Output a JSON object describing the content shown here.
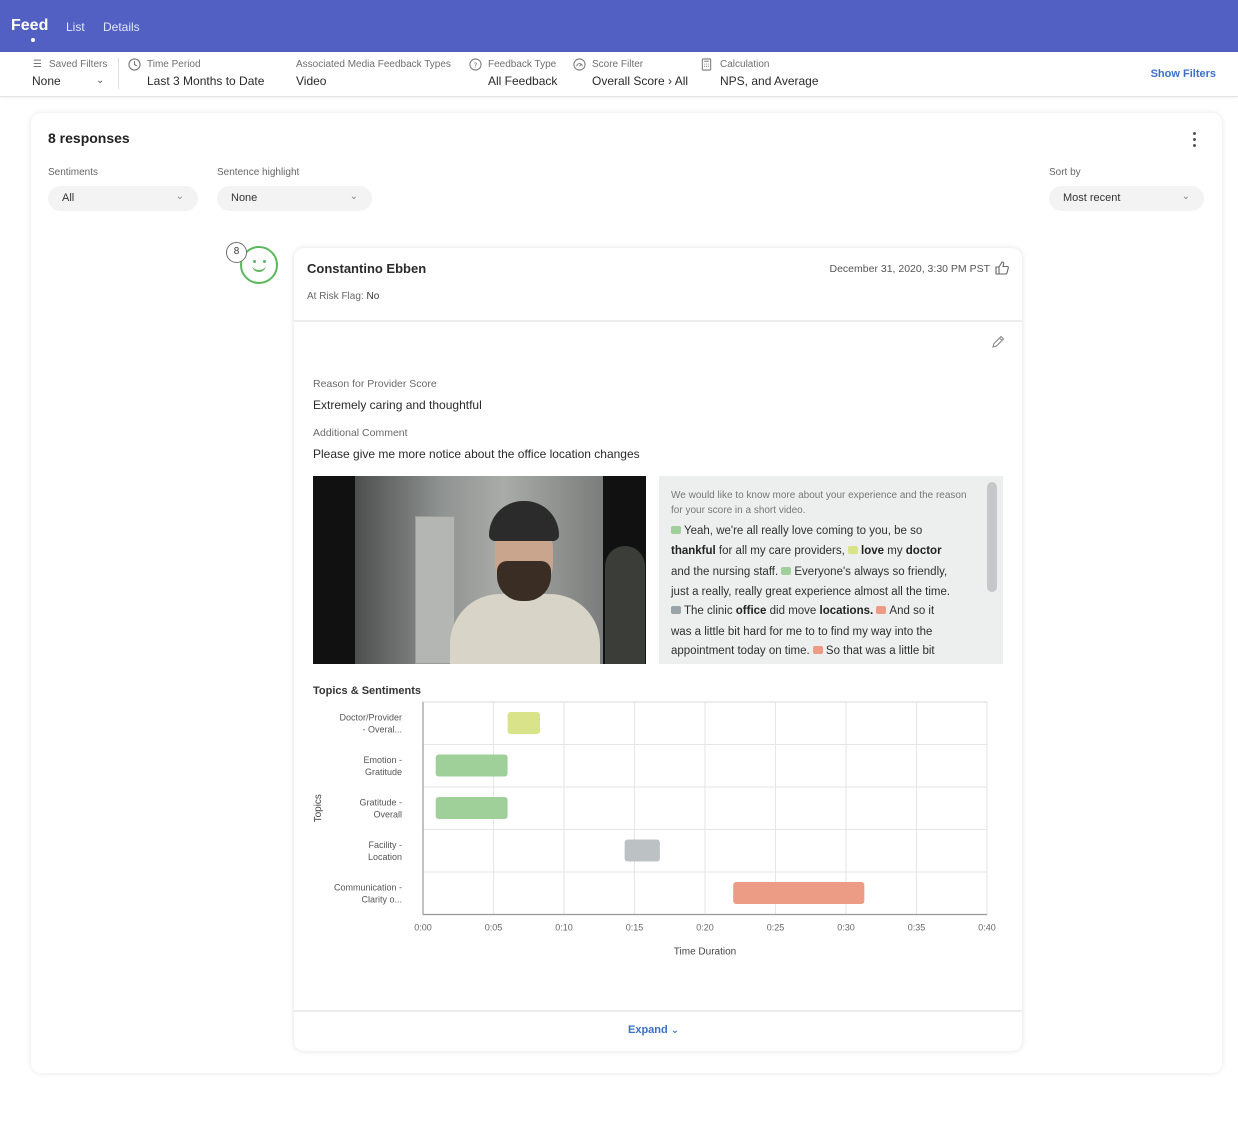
{
  "nav": {
    "brand": "Feed",
    "links": [
      "List",
      "Details"
    ]
  },
  "filters": {
    "saved_filters": {
      "label": "Saved Filters",
      "value": "None"
    },
    "time_period": {
      "label": "Time Period",
      "value": "Last 3 Months to Date"
    },
    "media_types": {
      "label": "Associated Media Feedback Types",
      "value": "Video"
    },
    "feedback_type": {
      "label": "Feedback Type",
      "value": "All Feedback"
    },
    "score_filter": {
      "label": "Score Filter",
      "value": "Overall Score › All"
    },
    "calculation": {
      "label": "Calculation",
      "value": "NPS, and Average"
    },
    "show_filters": "Show Filters"
  },
  "panel": {
    "count": "8 responses",
    "sentiments": {
      "label": "Sentiments",
      "value": "All"
    },
    "highlight": {
      "label": "Sentence highlight",
      "value": "None"
    },
    "sort": {
      "label": "Sort by",
      "value": "Most recent"
    }
  },
  "response": {
    "badge": "8",
    "name": "Constantino Ebben",
    "date": "December 31, 2020, 3:30 PM PST",
    "risk_label": "At Risk Flag:",
    "risk_value": "No",
    "q1_label": "Reason for Provider Score",
    "q1_answer": "Extremely caring and thoughtful",
    "q2_label": "Additional Comment",
    "q2_answer": "Please give me more notice about the office location changes",
    "transcript_prompt": "We would like to know more about your experience and the reason for your score in a short video.",
    "transcript": {
      "l1": "Yeah, we're all really love coming to you, be so",
      "l2a": "thankful",
      "l2b": " for all my care providers, ",
      "l2c": "love",
      "l2d": " my ",
      "l2e": "doctor",
      "l3a": "and the nursing staff. ",
      "l3b": "Everyone's always so friendly,",
      "l4": "just a really, really great experience almost all the time.",
      "l5a": "The clinic ",
      "l5b": "office",
      "l5c": " did move ",
      "l5d": "locations.",
      "l5e": "And so it",
      "l6": "was a little bit hard for me to to find my way into the",
      "l7a": "appointment today on time. ",
      "l7b": "So that was a little bit"
    },
    "expand": "Expand"
  },
  "colors": {
    "nav": "#5160c2",
    "positive": "#9fd09a",
    "neutral": "#d9e48a",
    "mixed": "#bcc1c4",
    "negative": "#ec9b84",
    "link": "#3b6fc9"
  },
  "chart_data": {
    "type": "bar",
    "orientation": "horizontal-gantt",
    "title": "Topics & Sentiments",
    "xlabel": "Time Duration",
    "ylabel": "Topics",
    "x_ticks": [
      "0:00",
      "0:05",
      "0:10",
      "0:15",
      "0:20",
      "0:25",
      "0:30",
      "0:35",
      "0:40"
    ],
    "xlim_seconds": [
      0,
      40
    ],
    "grid": true,
    "categories": [
      [
        "Doctor/Provider",
        "- Overal..."
      ],
      [
        "Emotion -",
        "Gratitude"
      ],
      [
        "Gratitude -",
        "Overall"
      ],
      [
        "Facility -",
        "Location"
      ],
      [
        "Communication -",
        "Clarity o..."
      ]
    ],
    "segments": [
      {
        "topic_index": 0,
        "start_s": 6.0,
        "end_s": 8.3,
        "sentiment": "neutral"
      },
      {
        "topic_index": 1,
        "start_s": 0.9,
        "end_s": 6.0,
        "sentiment": "positive"
      },
      {
        "topic_index": 2,
        "start_s": 0.9,
        "end_s": 6.0,
        "sentiment": "positive"
      },
      {
        "topic_index": 3,
        "start_s": 14.3,
        "end_s": 16.8,
        "sentiment": "mixed"
      },
      {
        "topic_index": 4,
        "start_s": 22.0,
        "end_s": 31.3,
        "sentiment": "negative"
      }
    ]
  }
}
